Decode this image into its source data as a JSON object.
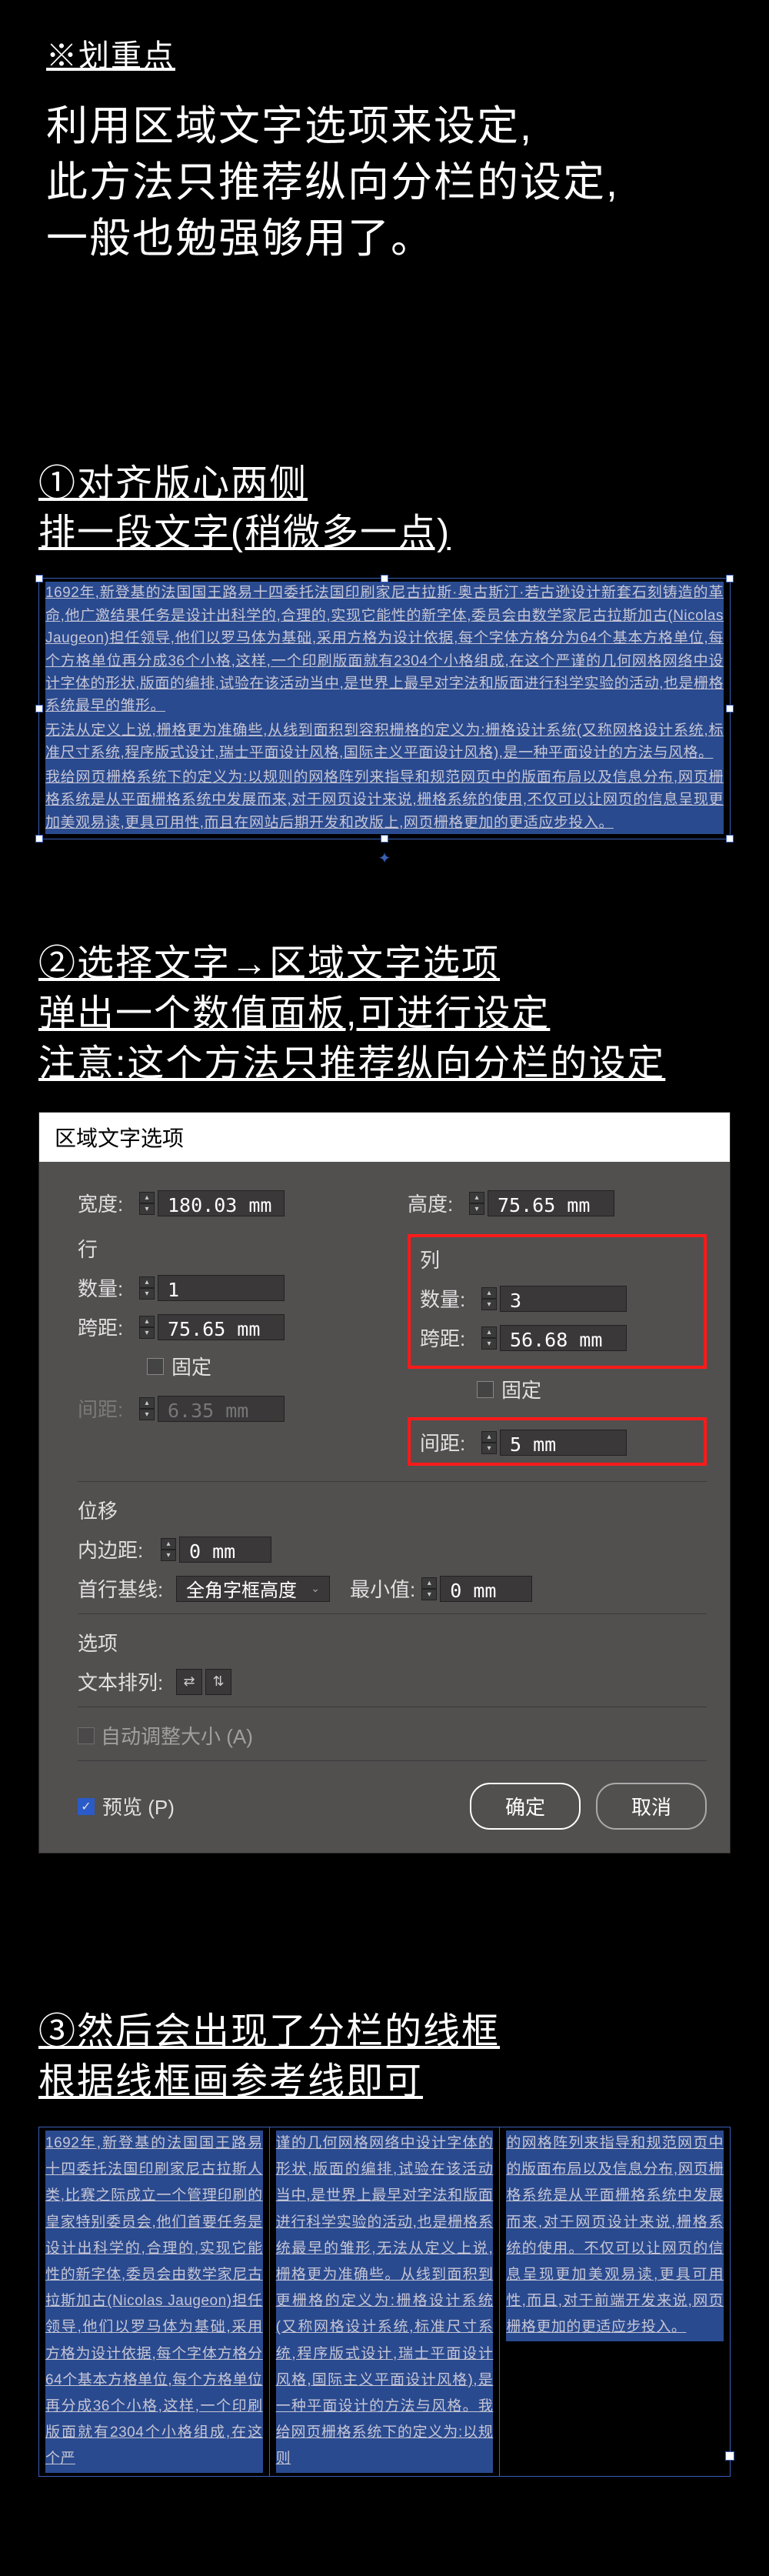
{
  "header": {
    "tag": "※划重点"
  },
  "intro": {
    "line1": "利用区域文字选项来设定,",
    "line2": "此方法只推荐纵向分栏的设定,",
    "line3": "一般也勉强够用了。"
  },
  "section1": {
    "title_line1": "①对齐版心两侧",
    "title_line2": "排一段文字(稍微多一点)",
    "body_p1": "1692年,新登基的法国国王路易十四委托法国印刷家尼古拉斯·奥古斯汀·若古逊设计新套石刻铸造的革命,他广邀结果任务是设计出科学的,合理的,实现它能性的新字体,委员会由数学家尼古拉斯加古(Nicolas Jaugeon)担任领导,他们以罗马体为基础,采用方格为设计依据,每个字体方格分为64个基本方格单位,每个方格单位再分成36个小格,这样,一个印刷版面就有2304个小格组成,在这个严谨的几何网格网络中设计字体的形状,版面的编排,试验在该活动当中,是世界上最早对字法和版面进行科学实验的活动,也是栅格系统最早的雏形。",
    "body_p2": "无法从定义上说,栅格更为准确些,从线到面积到容积栅格的定义为:栅格设计系统(又称网格设计系统,标准尺寸系统,程序版式设计,瑞士平面设计风格,国际主义平面设计风格),是一种平面设计的方法与风格。",
    "body_p3": "我给网页栅格系统下的定义为:以规则的网格阵列来指导和规范网页中的版面布局以及信息分布,网页栅格系统是从平面栅格系统中发展而来,对于网页设计来说,栅格系统的使用,不仅可以让网页的信息呈现更加美观易读,更具可用性,而且在网站后期开发和改版上,网页栅格更加的更适应步投入。"
  },
  "section2": {
    "title_line1": "②选择文字→区域文字选项",
    "title_line2": "弹出一个数值面板,可进行设定",
    "title_line3": "注意:这个方法只推荐纵向分栏的设定"
  },
  "dialog": {
    "title": "区域文字选项",
    "width_label": "宽度:",
    "width_value": "180.03 mm",
    "height_label": "高度:",
    "height_value": "75.65 mm",
    "rows_group": "行",
    "cols_group": "列",
    "count_label": "数量:",
    "row_count_value": "1",
    "col_count_value": "3",
    "span_label": "跨距:",
    "row_span_value": "75.65 mm",
    "col_span_value": "56.68 mm",
    "fixed_label": "固定",
    "gutter_label": "间距:",
    "row_gutter_value": "6.35 mm",
    "col_gutter_value": "5 mm",
    "offset_group": "位移",
    "inset_label": "内边距:",
    "inset_value": "0 mm",
    "baseline_label": "首行基线:",
    "baseline_value": "全角字框高度",
    "min_label": "最小值:",
    "min_value": "0 mm",
    "options_group": "选项",
    "textflow_label": "文本排列:",
    "auto_resize": "自动调整大小 (A)",
    "preview": "预览 (P)",
    "ok": "确定",
    "cancel": "取消"
  },
  "section3": {
    "title_line1": "③然后会出现了分栏的线框",
    "title_line2": "根据线框画参考线即可",
    "col1": "1692年,新登基的法国国王路易十四委托法国印刷家尼古拉斯人类,比赛之际成立一个管理印刷的皇家特别委员会,他们首要任务是设计出科学的,合理的,实现它能性的新字体,委员会由数学家尼古拉斯加古(Nicolas Jaugeon)担任领导,他们以罗马体为基础,采用方格为设计依据,每个字体方格分64个基本方格单位,每个方格单位再分成36个小格,这样,一个印刷版面就有2304个小格组成,在这个严",
    "col2": "谨的几何网格网络中设计字体的形状,版面的编排,试验在该活动当中,是世界上最早对字法和版面进行科学实验的活动,也是栅格系统最早的雏形,无法从定义上说,栅格更为准确些。从线到面积到更栅格的定义为:栅格设计系统(又称网格设计系统,标准尺寸系统,程序版式设计,瑞士平面设计风格,国际主义平面设计风格),是一种平面设计的方法与风格。我给网页栅格系统下的定义为:以规则",
    "col3": "的网格阵列来指导和规范网页中的版面布局以及信息分布,网页栅格系统是从平面栅格系统中发展而来,对于网页设计来说,栅格系统的使用。不仅可以让网页的信息呈现更加美观易读,更具可用性,而且,对于前端开发来说,网页栅格更加的更适应步投入。"
  },
  "chart_data": {
    "type": "table",
    "title": "区域文字选项",
    "fields": [
      {
        "label": "宽度",
        "value": 180.03,
        "unit": "mm"
      },
      {
        "label": "高度",
        "value": 75.65,
        "unit": "mm"
      },
      {
        "label": "行-数量",
        "value": 1
      },
      {
        "label": "行-跨距",
        "value": 75.65,
        "unit": "mm"
      },
      {
        "label": "行-间距",
        "value": 6.35,
        "unit": "mm",
        "enabled": false
      },
      {
        "label": "列-数量",
        "value": 3
      },
      {
        "label": "列-跨距",
        "value": 56.68,
        "unit": "mm"
      },
      {
        "label": "列-间距",
        "value": 5,
        "unit": "mm"
      },
      {
        "label": "内边距",
        "value": 0,
        "unit": "mm"
      },
      {
        "label": "首行基线",
        "value": "全角字框高度"
      },
      {
        "label": "最小值",
        "value": 0,
        "unit": "mm"
      }
    ]
  }
}
